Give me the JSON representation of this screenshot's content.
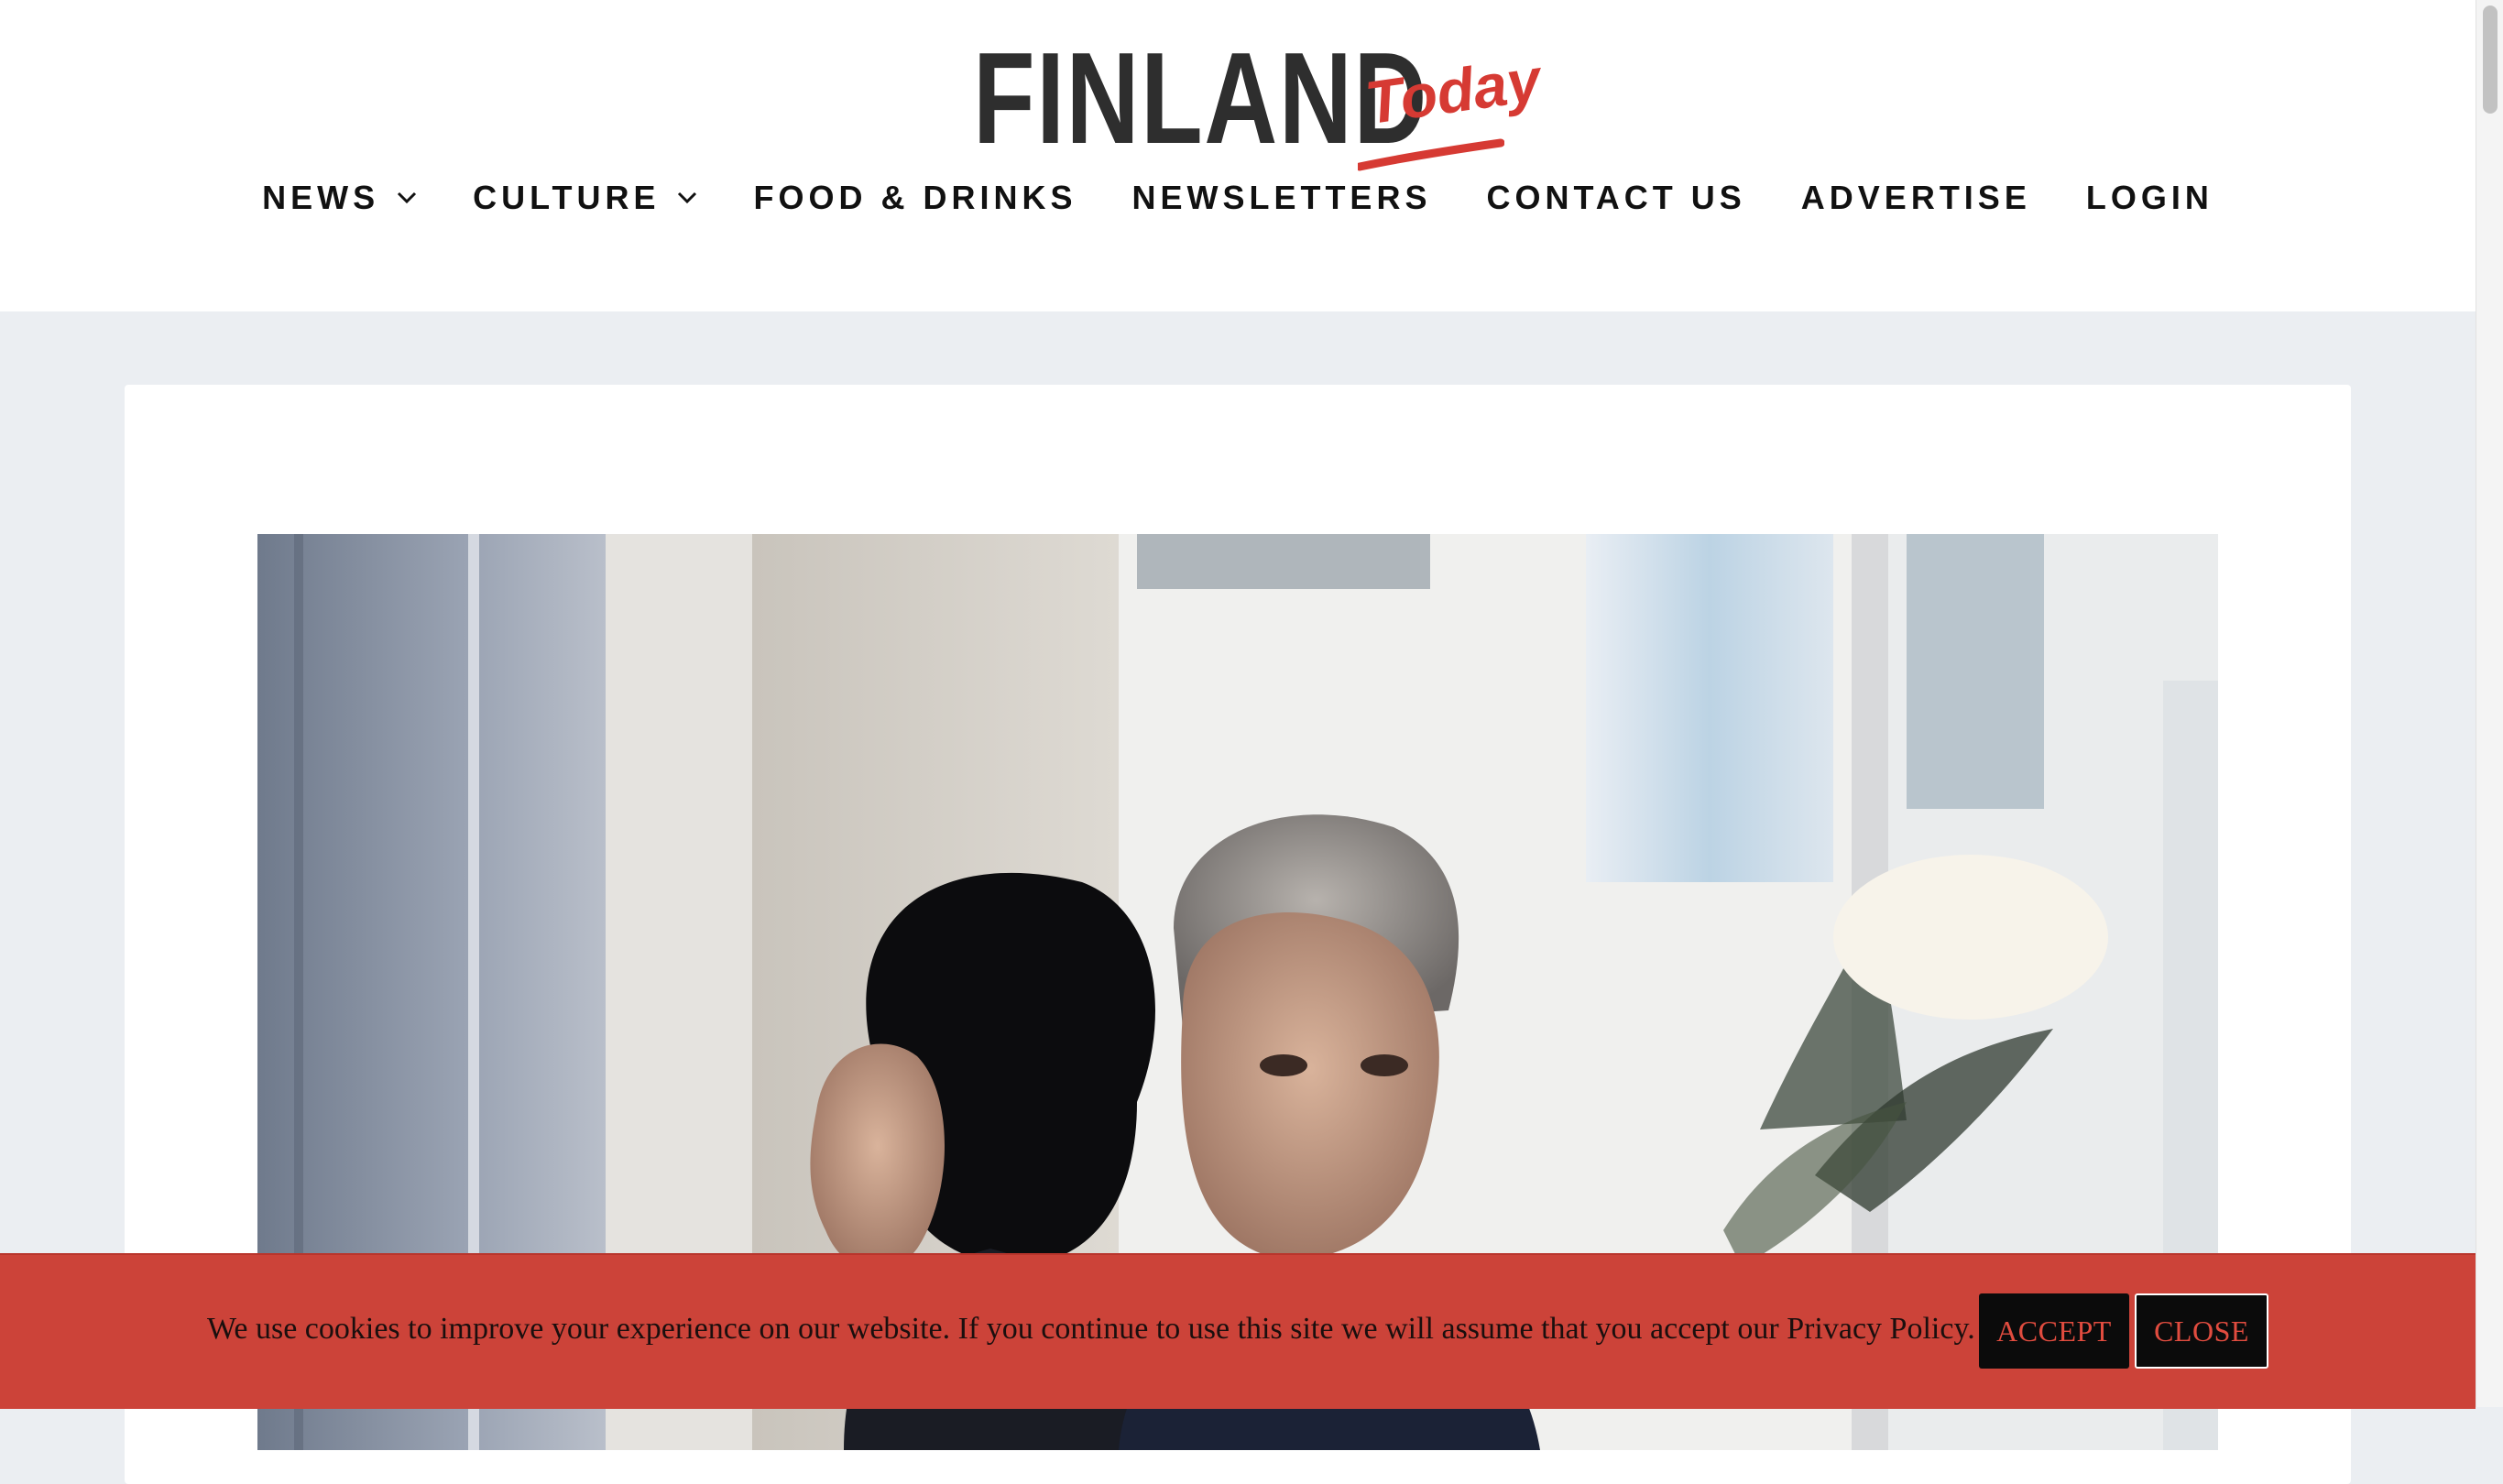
{
  "logo": {
    "main": "FINLAND",
    "sub": "Today"
  },
  "nav": {
    "items": [
      {
        "label": "NEWS",
        "dropdown": true
      },
      {
        "label": "CULTURE",
        "dropdown": true
      },
      {
        "label": "FOOD & DRINKS",
        "dropdown": false
      },
      {
        "label": "NEWSLETTERS",
        "dropdown": false
      },
      {
        "label": "CONTACT US",
        "dropdown": false
      },
      {
        "label": "ADVERTISE",
        "dropdown": false
      },
      {
        "label": "LOGIN",
        "dropdown": false
      }
    ]
  },
  "cookie": {
    "message": "We use cookies to improve your experience on our website. If you continue to use this site we will assume that you accept our Privacy Policy.",
    "accept_label": "ACCEPT",
    "close_label": "CLOSE"
  },
  "colors": {
    "brand_red": "#d63a33",
    "cookie_bg": "#cc4339",
    "page_bg": "#ebeef2",
    "button_bg": "#0b0b0b"
  }
}
